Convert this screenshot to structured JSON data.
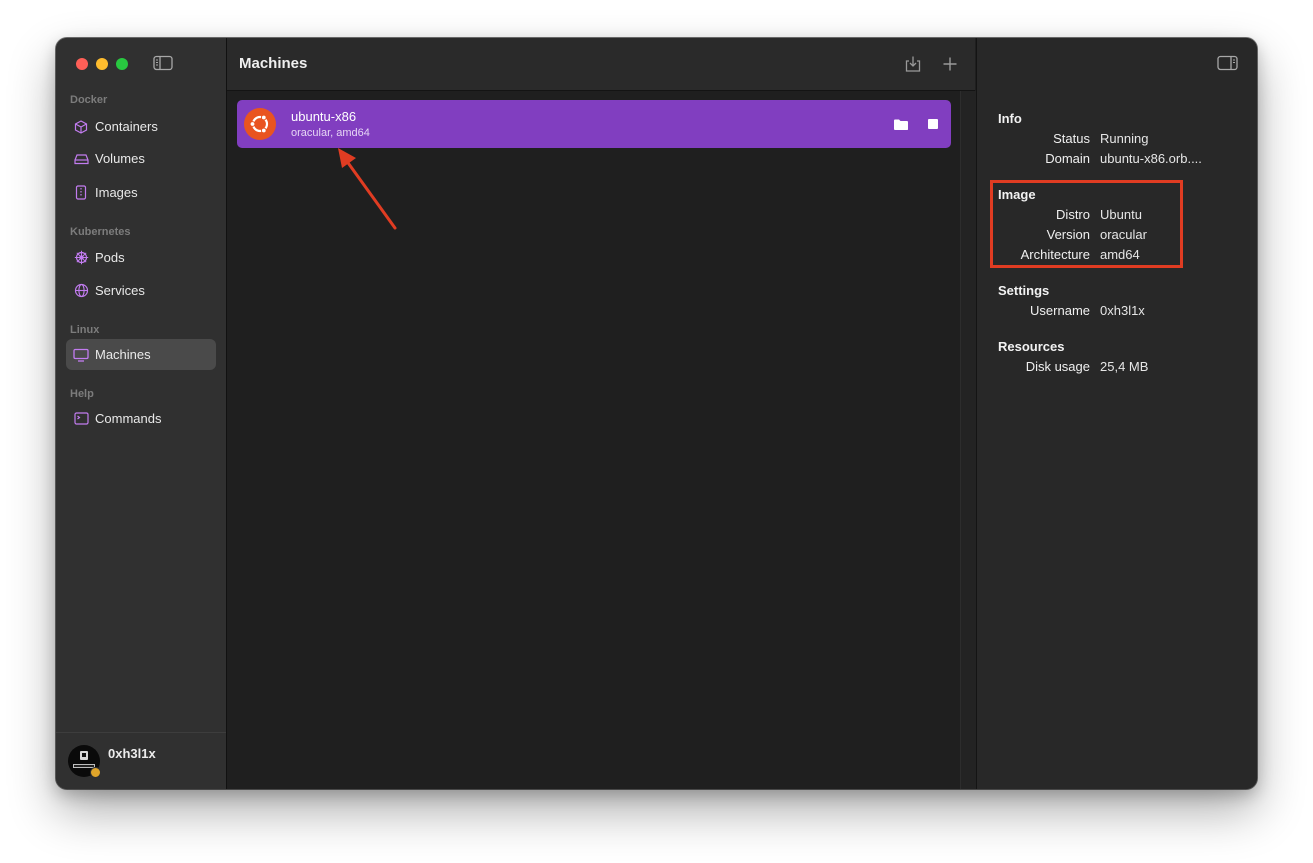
{
  "sidebar": {
    "sections": [
      {
        "label": "Docker",
        "items": [
          {
            "label": "Containers",
            "icon": "cube-icon"
          },
          {
            "label": "Volumes",
            "icon": "disk-icon"
          },
          {
            "label": "Images",
            "icon": "image-icon"
          }
        ]
      },
      {
        "label": "Kubernetes",
        "items": [
          {
            "label": "Pods",
            "icon": "helm-icon"
          },
          {
            "label": "Services",
            "icon": "globe-icon"
          }
        ]
      },
      {
        "label": "Linux",
        "items": [
          {
            "label": "Machines",
            "icon": "monitor-icon",
            "active": true
          }
        ]
      },
      {
        "label": "Help",
        "items": [
          {
            "label": "Commands",
            "icon": "terminal-icon"
          }
        ]
      }
    ],
    "user": {
      "name": "0xh3l1x"
    }
  },
  "main": {
    "title": "Machines",
    "machines": [
      {
        "name": "ubuntu-x86",
        "subtitle": "oracular, amd64",
        "status_color": "#813ec0"
      }
    ]
  },
  "details": {
    "info": {
      "heading": "Info",
      "rows": [
        {
          "key": "Status",
          "value": "Running"
        },
        {
          "key": "Domain",
          "value": "ubuntu-x86.orb...."
        }
      ]
    },
    "image": {
      "heading": "Image",
      "rows": [
        {
          "key": "Distro",
          "value": "Ubuntu"
        },
        {
          "key": "Version",
          "value": "oracular"
        },
        {
          "key": "Architecture",
          "value": "amd64"
        }
      ]
    },
    "settings": {
      "heading": "Settings",
      "rows": [
        {
          "key": "Username",
          "value": "0xh3l1x"
        }
      ]
    },
    "resources": {
      "heading": "Resources",
      "rows": [
        {
          "key": "Disk usage",
          "value": "25,4 MB"
        }
      ]
    }
  },
  "colors": {
    "accent": "#813ec0",
    "annotation": "#e03c22",
    "ubuntu": "#e95420"
  }
}
